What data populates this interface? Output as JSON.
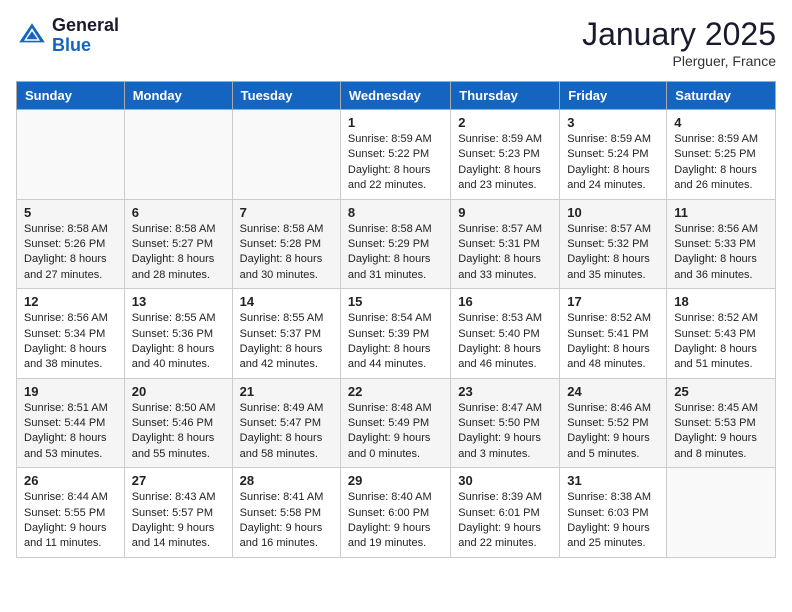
{
  "logo": {
    "general": "General",
    "blue": "Blue"
  },
  "title": "January 2025",
  "location": "Plerguer, France",
  "weekdays": [
    "Sunday",
    "Monday",
    "Tuesday",
    "Wednesday",
    "Thursday",
    "Friday",
    "Saturday"
  ],
  "weeks": [
    [
      {
        "day": "",
        "info": ""
      },
      {
        "day": "",
        "info": ""
      },
      {
        "day": "",
        "info": ""
      },
      {
        "day": "1",
        "info": "Sunrise: 8:59 AM\nSunset: 5:22 PM\nDaylight: 8 hours and 22 minutes."
      },
      {
        "day": "2",
        "info": "Sunrise: 8:59 AM\nSunset: 5:23 PM\nDaylight: 8 hours and 23 minutes."
      },
      {
        "day": "3",
        "info": "Sunrise: 8:59 AM\nSunset: 5:24 PM\nDaylight: 8 hours and 24 minutes."
      },
      {
        "day": "4",
        "info": "Sunrise: 8:59 AM\nSunset: 5:25 PM\nDaylight: 8 hours and 26 minutes."
      }
    ],
    [
      {
        "day": "5",
        "info": "Sunrise: 8:58 AM\nSunset: 5:26 PM\nDaylight: 8 hours and 27 minutes."
      },
      {
        "day": "6",
        "info": "Sunrise: 8:58 AM\nSunset: 5:27 PM\nDaylight: 8 hours and 28 minutes."
      },
      {
        "day": "7",
        "info": "Sunrise: 8:58 AM\nSunset: 5:28 PM\nDaylight: 8 hours and 30 minutes."
      },
      {
        "day": "8",
        "info": "Sunrise: 8:58 AM\nSunset: 5:29 PM\nDaylight: 8 hours and 31 minutes."
      },
      {
        "day": "9",
        "info": "Sunrise: 8:57 AM\nSunset: 5:31 PM\nDaylight: 8 hours and 33 minutes."
      },
      {
        "day": "10",
        "info": "Sunrise: 8:57 AM\nSunset: 5:32 PM\nDaylight: 8 hours and 35 minutes."
      },
      {
        "day": "11",
        "info": "Sunrise: 8:56 AM\nSunset: 5:33 PM\nDaylight: 8 hours and 36 minutes."
      }
    ],
    [
      {
        "day": "12",
        "info": "Sunrise: 8:56 AM\nSunset: 5:34 PM\nDaylight: 8 hours and 38 minutes."
      },
      {
        "day": "13",
        "info": "Sunrise: 8:55 AM\nSunset: 5:36 PM\nDaylight: 8 hours and 40 minutes."
      },
      {
        "day": "14",
        "info": "Sunrise: 8:55 AM\nSunset: 5:37 PM\nDaylight: 8 hours and 42 minutes."
      },
      {
        "day": "15",
        "info": "Sunrise: 8:54 AM\nSunset: 5:39 PM\nDaylight: 8 hours and 44 minutes."
      },
      {
        "day": "16",
        "info": "Sunrise: 8:53 AM\nSunset: 5:40 PM\nDaylight: 8 hours and 46 minutes."
      },
      {
        "day": "17",
        "info": "Sunrise: 8:52 AM\nSunset: 5:41 PM\nDaylight: 8 hours and 48 minutes."
      },
      {
        "day": "18",
        "info": "Sunrise: 8:52 AM\nSunset: 5:43 PM\nDaylight: 8 hours and 51 minutes."
      }
    ],
    [
      {
        "day": "19",
        "info": "Sunrise: 8:51 AM\nSunset: 5:44 PM\nDaylight: 8 hours and 53 minutes."
      },
      {
        "day": "20",
        "info": "Sunrise: 8:50 AM\nSunset: 5:46 PM\nDaylight: 8 hours and 55 minutes."
      },
      {
        "day": "21",
        "info": "Sunrise: 8:49 AM\nSunset: 5:47 PM\nDaylight: 8 hours and 58 minutes."
      },
      {
        "day": "22",
        "info": "Sunrise: 8:48 AM\nSunset: 5:49 PM\nDaylight: 9 hours and 0 minutes."
      },
      {
        "day": "23",
        "info": "Sunrise: 8:47 AM\nSunset: 5:50 PM\nDaylight: 9 hours and 3 minutes."
      },
      {
        "day": "24",
        "info": "Sunrise: 8:46 AM\nSunset: 5:52 PM\nDaylight: 9 hours and 5 minutes."
      },
      {
        "day": "25",
        "info": "Sunrise: 8:45 AM\nSunset: 5:53 PM\nDaylight: 9 hours and 8 minutes."
      }
    ],
    [
      {
        "day": "26",
        "info": "Sunrise: 8:44 AM\nSunset: 5:55 PM\nDaylight: 9 hours and 11 minutes."
      },
      {
        "day": "27",
        "info": "Sunrise: 8:43 AM\nSunset: 5:57 PM\nDaylight: 9 hours and 14 minutes."
      },
      {
        "day": "28",
        "info": "Sunrise: 8:41 AM\nSunset: 5:58 PM\nDaylight: 9 hours and 16 minutes."
      },
      {
        "day": "29",
        "info": "Sunrise: 8:40 AM\nSunset: 6:00 PM\nDaylight: 9 hours and 19 minutes."
      },
      {
        "day": "30",
        "info": "Sunrise: 8:39 AM\nSunset: 6:01 PM\nDaylight: 9 hours and 22 minutes."
      },
      {
        "day": "31",
        "info": "Sunrise: 8:38 AM\nSunset: 6:03 PM\nDaylight: 9 hours and 25 minutes."
      },
      {
        "day": "",
        "info": ""
      }
    ]
  ]
}
